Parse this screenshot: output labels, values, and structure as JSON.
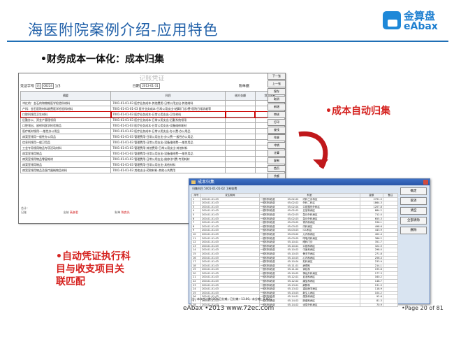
{
  "title": "海医附院案例介绍-应用特色",
  "logo": {
    "cn": "金算盘",
    "en": "eAbax"
  },
  "subtitle": "•财务成本一体化：成本归集",
  "label_auto": "•成本自动归集",
  "label_voucher": [
    "•自动凭证执行科",
    "目与收支项目关",
    "联匹配"
  ],
  "footer": "eAbax •2013 www.72ec.com",
  "page_label": "•Page 20 of 81",
  "win1": {
    "title": "记账凭证",
    "toolbar": {
      "voucher_no_label": "凭证字号",
      "voucher_type": "记",
      "voucher_no": "00224",
      "pages": "1/3",
      "date_label": "日期",
      "date": "2013-01-31",
      "attach_label": "附单据"
    },
    "headers": [
      "摘要",
      "科目",
      "借方金额",
      "贷方金额"
    ],
    "rows": [
      [
        "冲红的：金石的和物耗医学检验科材料",
        "7001-01-01-03 医疗业务成本-其他费用-日常公用支出-其他材料"
      ],
      [
        "产科：金石医院材料收费医学检验科材料",
        "7001-01-01-01-03 医疗业务成本-日常公用支出-结算(门诊)费-医院日常消耗等"
      ],
      [
        "口腔科领用卫生材料",
        "7001-01-01-03 医疗业务成本-日常公用支出-卫生材料"
      ],
      [
        "后勤办公、资金产管理领用",
        "7001-01-01-03 医疗业务成本-日常公用支出-后勤系统领用"
      ],
      [
        "口腔领出、放射科医学检验物品",
        "7001-01-01-03 医疗业务成本-日常公用支出-设备维修耗材"
      ],
      [
        "医疗耗材领用-一般性办公用品",
        "7001-01-01-03 医疗业务成本-日常公用支出-办公费-办公用品"
      ],
      [
        "病案室领用一般性办公用品",
        "7001-01-01-03 管理费用-日常公用支出-办公费-一般性办公用品"
      ],
      [
        "信息科领用一般卫用品",
        "7001-01-01-03 管理费用-日常公用支出-设备维修费-一般性用品"
      ],
      [
        "工会专用领用物品专项活动材料",
        "7001-01-01-03 管理费用-其他费用-日常公用支出-其他材料"
      ],
      [
        "病案室领用物品",
        "7001-01-01-03 管理费用-日常公用支出-设备维修费-一般性用品"
      ],
      [
        "病案室领用物品零星耗材",
        "7001-01-01-03 管理费用-日常公用支出-维修(护)费-专用耗材"
      ],
      [
        "病案室领用物品",
        "7001-01-01-03 管理费用-日常公用支出-其他材料"
      ],
      [
        "病案室领用物品及医疗器械物品材料",
        "7001-01-01-03 其他支出-药物材料-其他公共费用"
      ]
    ],
    "total_label": "合计：",
    "footer_left": "记账",
    "footer_mid": "出纳",
    "footer_mid_val": "高彦君",
    "footer_right": "制单",
    "footer_right_val": "陈良光"
  },
  "side_buttons": [
    "下一张",
    "上一张",
    "保存",
    "取消",
    "新增",
    "审核",
    "打印",
    "查找",
    "作废",
    "冲销",
    "计算",
    "复制",
    "首页",
    "余额",
    "借方",
    "自动生成",
    "自动分摊",
    "成本归集"
  ],
  "win2": {
    "title": "成本归集",
    "info": "归集科目 5001-01-01-02 卫材收费",
    "headers": [
      "序号",
      "发生期间",
      "科室",
      "金额",
      "备注"
    ],
    "rows": [
      [
        "1",
        "200-01-01-03",
        "一般材料收费",
        "05-02-02",
        "内科三月科区",
        "2791.5"
      ],
      [
        "2",
        "200-01-01-03",
        "一般材料收费",
        "05-02-02",
        "外科二科区",
        "1864.3"
      ],
      [
        "3",
        "200-01-01-03",
        "一般材料收费",
        "05-02-04",
        "口腔整形外科区",
        "1207.8"
      ],
      [
        "4",
        "200-01-01-03",
        "一般材料收费",
        "05-02-02",
        "五官科病区",
        "884.2"
      ],
      [
        "5",
        "200-01-01-03",
        "一般材料收费",
        "05-02-03",
        "急诊外科病区",
        "712.0"
      ],
      [
        "6",
        "200-01-01-03",
        "一般材料收费",
        "05-02-03",
        "急诊外科病区",
        "655.3"
      ],
      [
        "7",
        "200-01-01-03",
        "一般材料收费",
        "05-03-02",
        "肾内科病区",
        "536.1"
      ],
      [
        "8",
        "200-01-01-03",
        "一般材料收费",
        "05-03-02",
        "内科病区",
        "498.6"
      ],
      [
        "9",
        "200-01-01-03",
        "一般材料收费",
        "05-03-03",
        "ICU科区",
        "443.9"
      ],
      [
        "10",
        "200-01-01-03",
        "一般材料收费",
        "05-03-02",
        "儿内科病区",
        "402.4"
      ],
      [
        "11",
        "200-01-01-03",
        "一般材料收费",
        "05-03-05",
        "呼吸内科病区",
        "386.2"
      ],
      [
        "12",
        "200-01-01-03",
        "一般材料收费",
        "05-10-01",
        "眼科门诊",
        "351.7"
      ],
      [
        "13",
        "200-01-01-03",
        "一般材料收费",
        "05-10-01",
        "口腔科病区",
        "322.5"
      ],
      [
        "14",
        "200-01-01-03",
        "一般材料收费",
        "05-10-02",
        "中医科病区",
        "298.0"
      ],
      [
        "15",
        "200-01-01-03",
        "一般材料收费",
        "05-10-03",
        "骨关节病区",
        "271.8"
      ],
      [
        "16",
        "200-01-01-03",
        "一般材料收费",
        "05-10-03",
        "心内科病区",
        "256.4"
      ],
      [
        "17",
        "200-01-01-03",
        "一般材料收费",
        "05-10-04",
        "妇科病区",
        "233.9"
      ],
      [
        "18",
        "200-01-01-03",
        "一般材料收费",
        "05-11-01",
        "病理科",
        "214.1"
      ],
      [
        "19",
        "200-01-01-03",
        "一般材料收费",
        "05-11-02",
        "体检科",
        "195.6"
      ],
      [
        "20",
        "200-01-01-03",
        "一般材料收费",
        "05-10-02",
        "神经外科病区",
        "177.3"
      ],
      [
        "21",
        "200-01-01-03",
        "一般材料收费",
        "05-12-01",
        "血液科病区",
        "160.2"
      ],
      [
        "22",
        "200-01-01-03",
        "一般材料收费",
        "05-12-02",
        "康复科病区",
        "148.7"
      ],
      [
        "23",
        "200-01-01-03",
        "一般材料收费",
        "05-13-01",
        "麻醉科",
        "131.5"
      ],
      [
        "24",
        "200-01-01-03",
        "一般材料收费",
        "05-13-02",
        "重症医学病区",
        "118.9"
      ],
      [
        "25",
        "200-01-01-03",
        "一般材料收费",
        "05-13-03",
        "新生儿病区",
        "104.2"
      ],
      [
        "26",
        "200-01-01-03",
        "一般材料收费",
        "05-14-01",
        "感染科病区",
        "92.6"
      ],
      [
        "27",
        "200-01-01-03",
        "一般材料收费",
        "05-14-02",
        "肿瘤科病区",
        "81.3"
      ],
      [
        "28",
        "200-01-01-03",
        "一般材料收费",
        "05-14-02",
        "泌尿外科病区",
        "70.9"
      ]
    ],
    "buttons": [
      "确定",
      "取消",
      "清空",
      "全部清除",
      "删除"
    ],
    "footer": "注：本次合计数100%已分摊，已分摊：13.00，未分摊：0.00元"
  }
}
